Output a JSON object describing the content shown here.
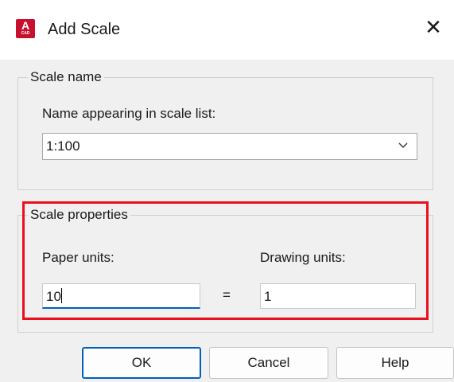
{
  "dialog": {
    "title": "Add Scale",
    "app_icon_letter": "A",
    "app_icon_sub": "CAD",
    "close_glyph": "✕"
  },
  "scale_name": {
    "legend": "Scale name",
    "field_label": "Name appearing in scale list:",
    "value": "1:100"
  },
  "scale_properties": {
    "legend": "Scale properties",
    "paper_label": "Paper units:",
    "paper_value": "10",
    "equals": "=",
    "drawing_label": "Drawing units:",
    "drawing_value": "1"
  },
  "buttons": {
    "ok": "OK",
    "cancel": "Cancel",
    "help": "Help"
  },
  "colors": {
    "highlight": "#e8101e",
    "focus": "#005fb8",
    "app_icon": "#c8102e"
  },
  "icons": [
    "autocad-app-icon",
    "close-icon",
    "chevron-down-icon"
  ]
}
